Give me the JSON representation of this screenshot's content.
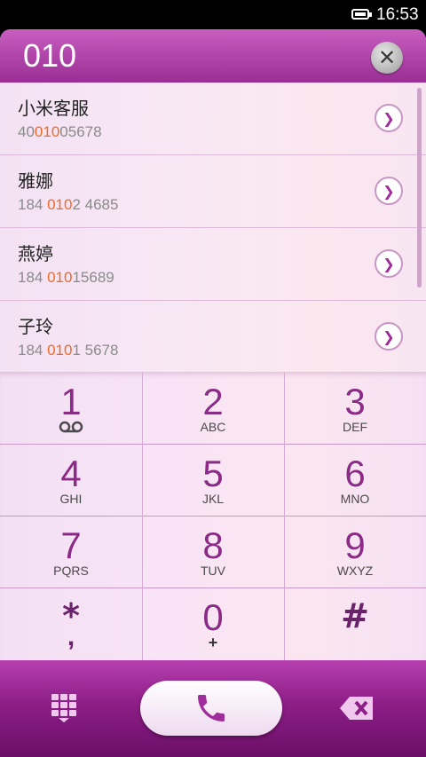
{
  "status": {
    "time": "16:53",
    "battery_level": 0.8
  },
  "dialer": {
    "input": "010",
    "clear_glyph": "✕"
  },
  "contacts": [
    {
      "name": "小米客服",
      "pre": "40",
      "match": "010",
      "post": "05678"
    },
    {
      "name": "雅娜",
      "pre": "184 ",
      "match": "010",
      "post": "2 4685"
    },
    {
      "name": "燕婷",
      "pre": "184 ",
      "match": "010",
      "post": "15689"
    },
    {
      "name": "子玲",
      "pre": "184 ",
      "match": "010",
      "post": "1 5678"
    }
  ],
  "keys": [
    {
      "digit": "1",
      "letters": "",
      "icon": "voicemail-icon"
    },
    {
      "digit": "2",
      "letters": "ABC"
    },
    {
      "digit": "3",
      "letters": "DEF"
    },
    {
      "digit": "4",
      "letters": "GHI"
    },
    {
      "digit": "5",
      "letters": "JKL"
    },
    {
      "digit": "6",
      "letters": "MNO"
    },
    {
      "digit": "7",
      "letters": "PQRS"
    },
    {
      "digit": "8",
      "letters": "TUV"
    },
    {
      "digit": "9",
      "letters": "WXYZ"
    },
    {
      "digit": "*",
      "letters": ","
    },
    {
      "digit": "0",
      "letters": "+"
    },
    {
      "digit": "#",
      "letters": ""
    }
  ],
  "colors": {
    "accent": "#9a2e94",
    "match": "#f06a25",
    "digit": "#8c2a88"
  },
  "icons": {
    "arrow": "chevron-right-icon",
    "call": "phone-icon",
    "keypad": "keypad-grid-icon",
    "delete": "backspace-icon"
  }
}
